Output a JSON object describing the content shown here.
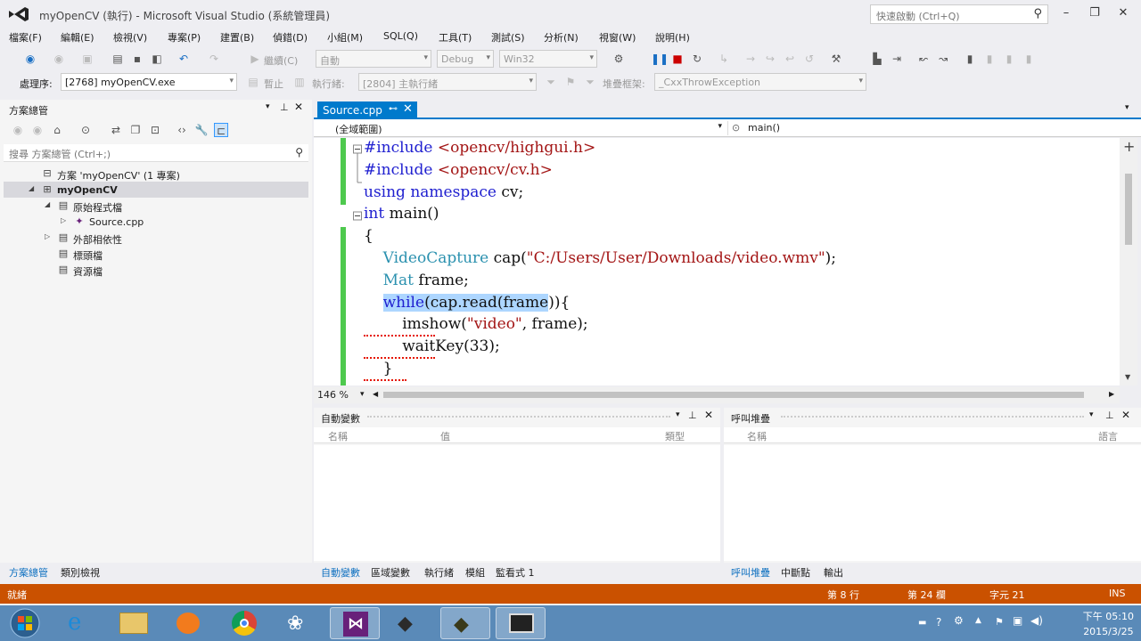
{
  "window": {
    "title": "myOpenCV (執行) - Microsoft Visual Studio (系統管理員)",
    "quick_launch_placeholder": "快速啟動 (Ctrl+Q)"
  },
  "menu": [
    "檔案(F)",
    "編輯(E)",
    "檢視(V)",
    "專案(P)",
    "建置(B)",
    "偵錯(D)",
    "小組(M)",
    "SQL(Q)",
    "工具(T)",
    "測試(S)",
    "分析(N)",
    "視窗(W)",
    "說明(H)"
  ],
  "toolbar": {
    "continue_label": "繼續(C)",
    "config_blank": "自動",
    "config": "Debug",
    "platform": "Win32",
    "process_label": "處理序:",
    "process_value": "[2768] myOpenCV.exe",
    "stop_label": "暫止",
    "thread_label": "執行緒:",
    "thread_value": "[2804] 主執行緒",
    "stack_label": "堆疊框架:",
    "stack_value": "_CxxThrowException"
  },
  "solution_explorer": {
    "title": "方案總管",
    "search_placeholder": "搜尋 方案總管 (Ctrl+;)",
    "tree": [
      {
        "label": "方案 'myOpenCV' (1 專案)",
        "level": 0,
        "icon": "solution-icon",
        "expanded": null
      },
      {
        "label": "myOpenCV",
        "level": 0,
        "icon": "project-icon",
        "expanded": true,
        "selected": true
      },
      {
        "label": "原始程式檔",
        "level": 1,
        "icon": "folder-icon",
        "expanded": true
      },
      {
        "label": "Source.cpp",
        "level": 2,
        "icon": "cpp-file-icon",
        "expanded": false
      },
      {
        "label": "外部相依性",
        "level": 1,
        "icon": "folder-icon",
        "expanded": false
      },
      {
        "label": "標頭檔",
        "level": 1,
        "icon": "folder-icon",
        "expanded": null
      },
      {
        "label": "資源檔",
        "level": 1,
        "icon": "folder-icon",
        "expanded": null
      }
    ],
    "tabs": [
      "方案總管",
      "類別檢視"
    ]
  },
  "editor": {
    "tab_label": "Source.cpp",
    "nav_scope": "(全域範圍)",
    "nav_member": "main()",
    "zoom": "146 %"
  },
  "code_lines": [
    {
      "parts": [
        {
          "t": "#include ",
          "c": "kw"
        },
        {
          "t": "<opencv/highgui.h>",
          "c": "str"
        }
      ]
    },
    {
      "parts": [
        {
          "t": "#include ",
          "c": "kw"
        },
        {
          "t": "<opencv/cv.h>",
          "c": "str"
        }
      ]
    },
    {
      "parts": [
        {
          "t": "using namespace ",
          "c": "kw"
        },
        {
          "t": "cv;",
          "c": ""
        }
      ]
    },
    {
      "parts": [
        {
          "t": "int ",
          "c": "kw"
        },
        {
          "t": "main()",
          "c": ""
        }
      ]
    },
    {
      "parts": [
        {
          "t": "{",
          "c": ""
        }
      ]
    },
    {
      "parts": [
        {
          "t": "    ",
          "c": ""
        },
        {
          "t": "VideoCapture ",
          "c": "cls-c"
        },
        {
          "t": "cap(",
          "c": ""
        },
        {
          "t": "\"C:/Users/User/Downloads/video.wmv\"",
          "c": "str"
        },
        {
          "t": ");",
          "c": ""
        }
      ]
    },
    {
      "parts": [
        {
          "t": "    ",
          "c": ""
        },
        {
          "t": "Mat ",
          "c": "cls-c"
        },
        {
          "t": "frame;",
          "c": ""
        }
      ]
    },
    {
      "parts": [
        {
          "t": "    ",
          "c": ""
        },
        {
          "t": "while",
          "c": "kw hl"
        },
        {
          "t": "(cap.read(frame",
          "c": "hl"
        },
        {
          "t": ")){",
          "c": ""
        }
      ]
    },
    {
      "parts": [
        {
          "t": "        imshow(",
          "c": ""
        },
        {
          "t": "\"video\"",
          "c": "str"
        },
        {
          "t": ", frame);",
          "c": ""
        }
      ]
    },
    {
      "parts": [
        {
          "t": "        waitKey(33);",
          "c": ""
        }
      ]
    },
    {
      "parts": [
        {
          "t": "    }",
          "c": ""
        }
      ]
    }
  ],
  "autos_panel": {
    "title": "自動變數",
    "columns": [
      "名稱",
      "值",
      "類型"
    ],
    "tabs": [
      "自動變數",
      "區域變數",
      "執行緒",
      "模組",
      "監看式 1"
    ]
  },
  "callstack_panel": {
    "title": "呼叫堆疊",
    "columns": [
      "名稱",
      "語言"
    ],
    "tabs": [
      "呼叫堆疊",
      "中斷點",
      "輸出"
    ]
  },
  "statusbar": {
    "state": "就緒",
    "line": "第 8 行",
    "col": "第 24 欄",
    "ch": "字元 21",
    "mode": "INS"
  },
  "taskbar": {
    "time": "下午 05:10",
    "date": "2015/3/25"
  },
  "colors": {
    "accent": "#007acc",
    "statusbar": "#ca5100",
    "taskbar": "#5a8ab8"
  }
}
